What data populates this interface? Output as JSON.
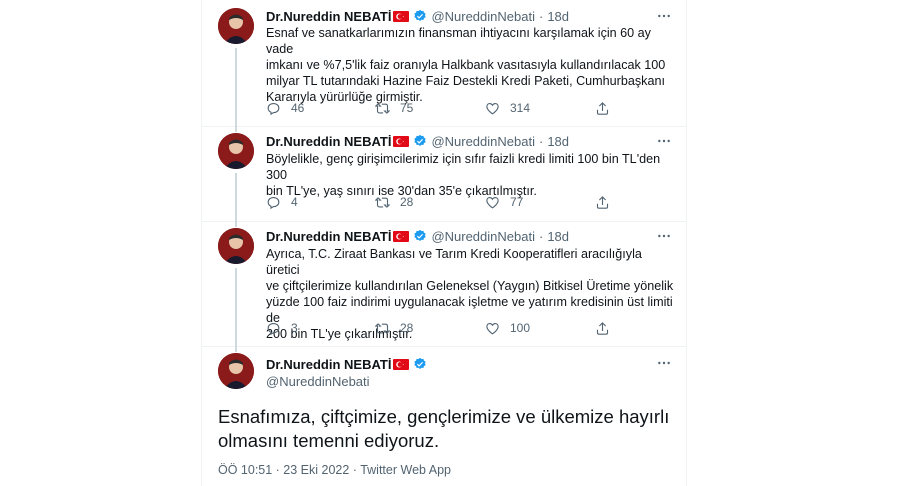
{
  "author": {
    "name": "Dr.Nureddin NEBATİ",
    "handle": "@NureddinNebati"
  },
  "tweets": [
    {
      "time": "18d",
      "text": "Esnaf ve sanatkarlarımızın finansman ihtiyacını karşılamak için 60 ay vade\nimkanı ve %7,5'lik faiz oranıyla Halkbank vasıtasıyla kullandırılacak 100\nmilyar TL tutarındaki Hazine Faiz Destekli Kredi Paketi, Cumhurbaşkanı\nKararıyla yürürlüğe girmiştir.",
      "replies": "46",
      "retweets": "75",
      "likes": "314"
    },
    {
      "time": "18d",
      "text": "Böylelikle, genç girişimcilerimiz için sıfır faizli kredi limiti 100 bin TL'den 300\nbin TL'ye, yaş sınırı ise 30'dan 35'e çıkartılmıştır.",
      "replies": "4",
      "retweets": "28",
      "likes": "77"
    },
    {
      "time": "18d",
      "text": "Ayrıca, T.C. Ziraat Bankası ve Tarım Kredi Kooperatifleri aracılığıyla üretici\nve çiftçilerimize kullandırılan Geleneksel (Yaygın) Bitkisel Üretime yönelik\nyüzde 100 faiz indirimi uygulanacak işletme ve yatırım kredisinin üst limiti de\n200 bin TL'ye çıkarılmıştır.",
      "replies": "3",
      "retweets": "28",
      "likes": "100"
    }
  ],
  "main_tweet": {
    "text": "Esnafımıza, çiftçimize, gençlerimize ve ülkemize hayırlı\nolmasını temenni ediyoruz.",
    "timestamp": "ÖÖ 10:51 · 23 Eki 2022 · Twitter Web App"
  },
  "icons": {
    "reply": "reply-icon",
    "retweet": "retweet-icon",
    "like": "heart-icon",
    "share": "share-icon",
    "more": "more-icon",
    "verified": "verified-badge-icon",
    "flag": "turkey-flag-icon"
  },
  "colors": {
    "accent": "#1d9bf0",
    "text": "#0f1419",
    "muted": "#536471",
    "flag_red": "#e30a17",
    "border": "#eff3f4"
  }
}
